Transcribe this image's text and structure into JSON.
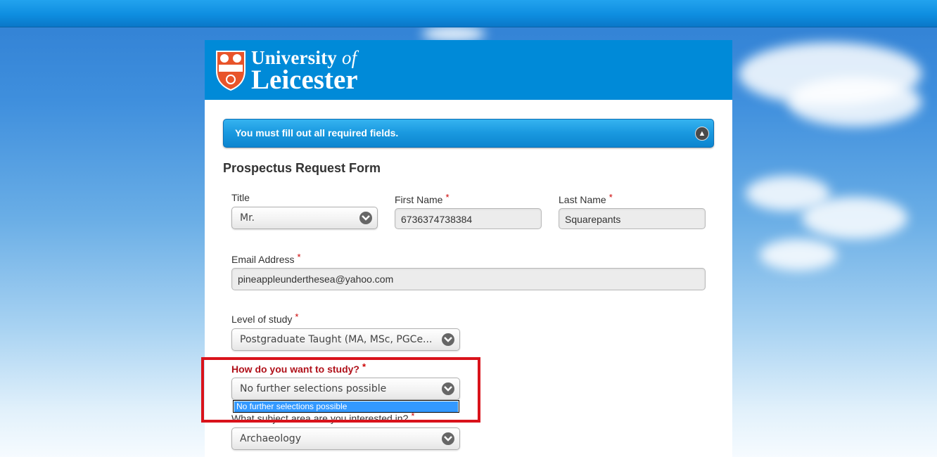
{
  "logo": {
    "line1_a": "University",
    "line1_b": "of",
    "line2": "Leicester"
  },
  "alert": {
    "message": "You must fill out all required fields.",
    "icon": "warning-icon"
  },
  "form": {
    "title": "Prospectus Request Form",
    "required_marker": "*",
    "title_field": {
      "label": "Title",
      "value": "Mr."
    },
    "first_name": {
      "label": "First Name",
      "value": "6736374738384"
    },
    "last_name": {
      "label": "Last Name",
      "value": "Squarepants"
    },
    "email": {
      "label": "Email Address",
      "value": "pineappleunderthesea@yahoo.com"
    },
    "level_of_study": {
      "label": "Level of study",
      "value": "Postgraduate Taught (MA, MSc, PGCe..."
    },
    "study_mode": {
      "label": "How do you want to study?",
      "value": "No further selections possible",
      "options": [
        "No further selections possible"
      ]
    },
    "subject_area": {
      "label": "What subject area are you interested in?",
      "value": "Archaeology"
    }
  },
  "colors": {
    "header": "#008ad8",
    "error": "#b0111a",
    "highlight": "#d9131b",
    "option_selected": "#3399ff"
  }
}
